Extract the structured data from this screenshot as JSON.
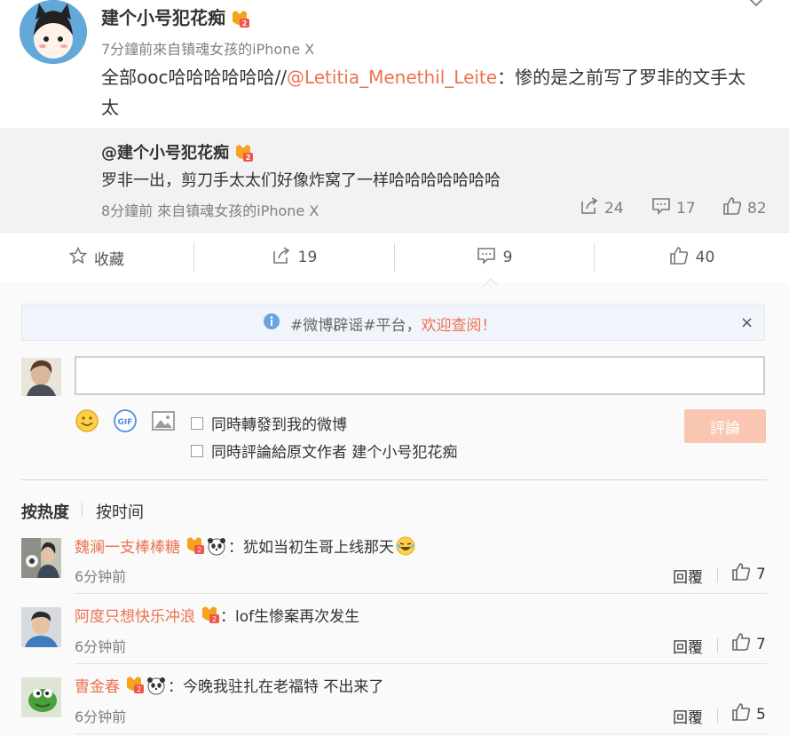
{
  "post": {
    "author": "建个小号犯花痴",
    "meta": "7分鐘前來自镇魂女孩的iPhone X",
    "text_pre": "全部ooc哈哈哈哈哈哈//",
    "mention": "@Letitia_Menethil_Leite",
    "text_post": "：惨的是之前写了罗非的文手太太"
  },
  "quoted": {
    "author": "@建个小号犯花痴",
    "text": "罗非一出，剪刀手太太们好像炸窝了一样哈哈哈哈哈哈哈",
    "meta": "8分鐘前 來自镇魂女孩的iPhone X",
    "reposts": "24",
    "comments": "17",
    "likes": "82"
  },
  "actions": {
    "favorite": "收藏",
    "reposts": "19",
    "comments": "9",
    "likes": "40"
  },
  "notice": {
    "text": "#微博辟谣#平台，",
    "link": "欢迎查阅！",
    "close": "×"
  },
  "composer": {
    "repost_option": "同時轉發到我的微博",
    "comment_origin_option": "同時評論給原文作者 建个小号犯花痴",
    "submit": "評論",
    "gif_label": "GIF"
  },
  "sort": {
    "hot": "按热度",
    "time": "按时间"
  },
  "comments": [
    {
      "user": "魏澜一支棒棒糖",
      "text": "：犹如当初生哥上线那天",
      "time": "6分钟前",
      "reply": "回覆",
      "likes": "7"
    },
    {
      "user": "阿度只想快乐冲浪",
      "text": "：lof生惨案再次发生",
      "time": "6分钟前",
      "reply": "回覆",
      "likes": "7"
    },
    {
      "user": "曺金春",
      "text": "：今晚我驻扎在老福特 不出来了",
      "time": "6分钟前",
      "reply": "回覆",
      "likes": "5"
    }
  ],
  "colors": {
    "accent": "#eb7350",
    "muted": "#808080",
    "button_disabled": "#f9c6b1"
  },
  "icons": {
    "repost": "repost-icon",
    "comment": "comment-icon",
    "like": "thumbs-up-icon",
    "favorite": "star-icon",
    "info": "info-icon"
  }
}
